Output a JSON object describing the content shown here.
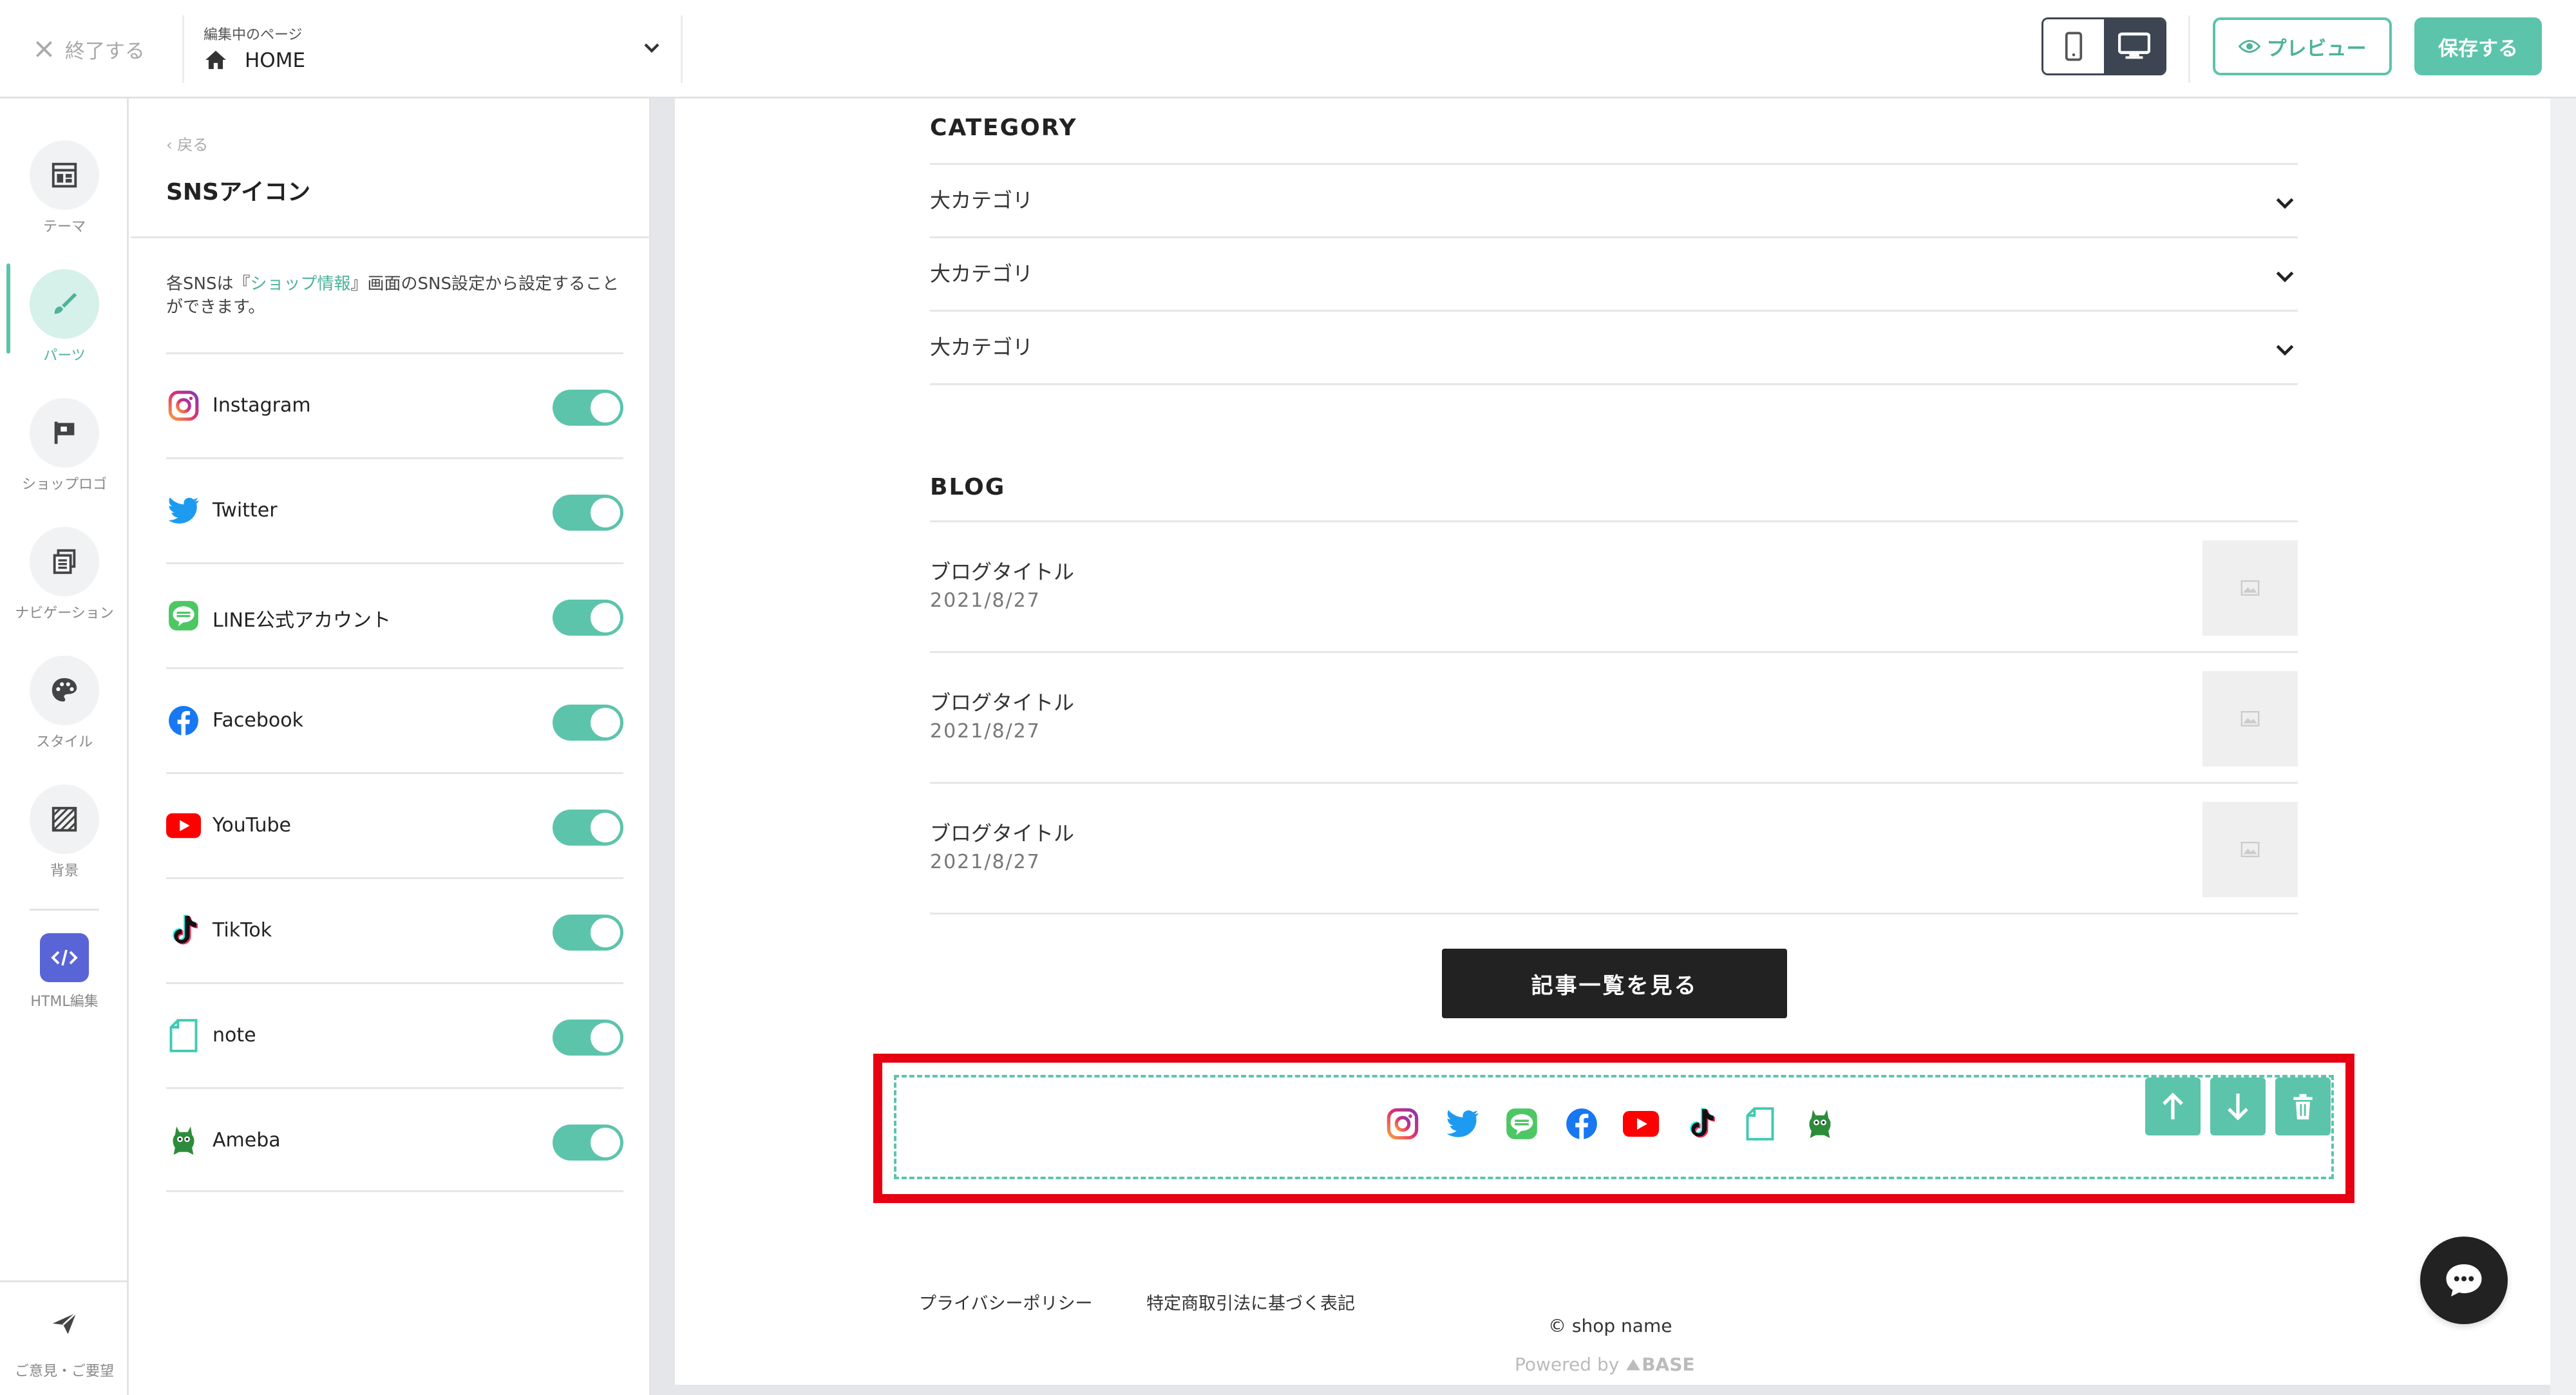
{
  "topbar": {
    "exit_label": "終了する",
    "editing_page_label": "編集中のページ",
    "page_name": "HOME",
    "preview_label": "プレビュー",
    "save_label": "保存する"
  },
  "rail": {
    "theme": "テーマ",
    "parts": "パーツ",
    "shop_logo": "ショップロゴ",
    "navigation": "ナビゲーション",
    "style": "スタイル",
    "background": "背景",
    "html_edit": "HTML編集",
    "feedback": "ご意見・ご要望"
  },
  "panel": {
    "back_label": "戻る",
    "title": "SNSアイコン",
    "desc_prefix": "各SNSは『",
    "desc_link": "ショップ情報",
    "desc_suffix": "』画面のSNS設定から設定することができます。",
    "items": [
      {
        "label": "Instagram",
        "enabled": true
      },
      {
        "label": "Twitter",
        "enabled": true
      },
      {
        "label": "LINE公式アカウント",
        "enabled": true
      },
      {
        "label": "Facebook",
        "enabled": true
      },
      {
        "label": "YouTube",
        "enabled": true
      },
      {
        "label": "TikTok",
        "enabled": true
      },
      {
        "label": "note",
        "enabled": true
      },
      {
        "label": "Ameba",
        "enabled": true
      }
    ]
  },
  "preview": {
    "category_title": "CATEGORY",
    "categories": [
      "大カテゴリ",
      "大カテゴリ",
      "大カテゴリ"
    ],
    "blog_title": "BLOG",
    "blog_posts": [
      {
        "title": "ブログタイトル",
        "date": "2021/8/27"
      },
      {
        "title": "ブログタイトル",
        "date": "2021/8/27"
      },
      {
        "title": "ブログタイトル",
        "date": "2021/8/27"
      }
    ],
    "more_button": "記事一覧を見る",
    "footer_privacy": "プライバシーポリシー",
    "footer_legal": "特定商取引法に基づく表記",
    "copyright": "© shop name",
    "powered_by": "Powered by",
    "powered_brand": "BASE"
  },
  "colors": {
    "accent": "#5cc4ab",
    "highlight": "#e60012",
    "html_badge": "#5964d6",
    "dark": "#3d4552"
  }
}
